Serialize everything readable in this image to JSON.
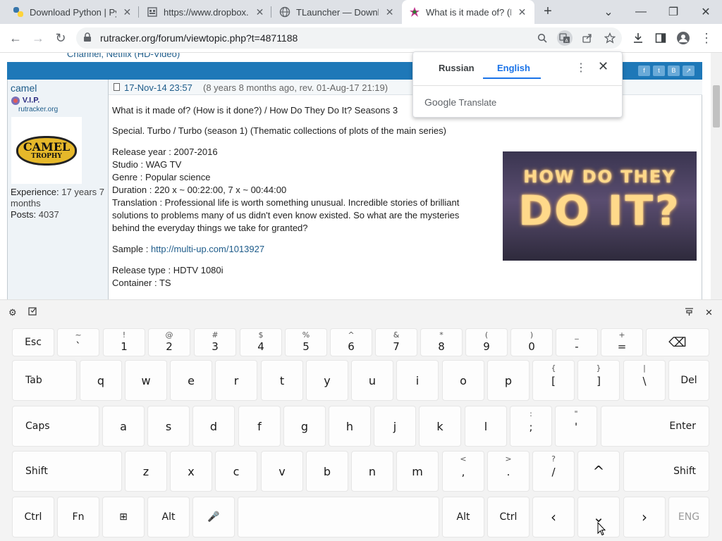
{
  "tabs": [
    {
      "title": "Download Python | Pyt",
      "icon": "python-icon"
    },
    {
      "title": "https://www.dropbox.c",
      "icon": "page-icon"
    },
    {
      "title": "TLauncher — Downloa",
      "icon": "globe-icon"
    },
    {
      "title": "What is it made of? (H",
      "icon": "rutracker-icon",
      "active": true
    }
  ],
  "address": {
    "url": "rutracker.org/forum/viewtopic.php?t=4871188"
  },
  "translate_popup": {
    "source_lang": "Russian",
    "target_lang": "English",
    "brand": "Google",
    "brand_suffix": "Translate"
  },
  "page": {
    "top_link": "Channel, Netflix (HD-Video)",
    "user": {
      "name": "camel",
      "rank": "V.I.P.",
      "site": "rutracker.org",
      "avatar_line1": "CAMEL",
      "avatar_line2": "TROPHY",
      "experience_label": "Experience:",
      "experience_value": "17 years 7 months",
      "posts_label": "Posts:",
      "posts_value": "4037"
    },
    "post": {
      "date": "17-Nov-14 23:57",
      "ago": "(8 years 8 months ago, rev. 01-Aug-17 21:19)",
      "title": "What is it made of? (How is it done?) / How Do They Do It? Seasons 3",
      "special": "Special. Turbo / Turbo (season 1) (Thematic collections of plots of the main series)",
      "release_year": "Release year : 2007-2016",
      "studio": "Studio : WAG TV",
      "genre": "Genre : Popular science",
      "duration": "Duration : 220 x ~ 00:22:00, 7 x ~ 00:44:00",
      "translation_l1": "Translation : Professional life is worth something unusual. Incredible stories of brilliant",
      "translation_l2": "solutions to problems many of us didn't even know existed. So what are the mysteries",
      "translation_l3": "behind the everyday things we take for granted?",
      "sample_label": "Sample :",
      "sample_link": "http://multi-up.com/1013927",
      "release_type": "Release type : HDTV 1080i",
      "container": "Container : TS",
      "poster_line1": "HOW DO THEY",
      "poster_line2": "DO IT?"
    }
  },
  "keyboard": {
    "row1": [
      {
        "sub": "",
        "main": "Esc"
      },
      {
        "sub": "~",
        "main": "`"
      },
      {
        "sub": "!",
        "main": "1"
      },
      {
        "sub": "@",
        "main": "2"
      },
      {
        "sub": "#",
        "main": "3"
      },
      {
        "sub": "$",
        "main": "4"
      },
      {
        "sub": "%",
        "main": "5"
      },
      {
        "sub": "^",
        "main": "6"
      },
      {
        "sub": "&",
        "main": "7"
      },
      {
        "sub": "*",
        "main": "8"
      },
      {
        "sub": "(",
        "main": "9"
      },
      {
        "sub": ")",
        "main": "0"
      },
      {
        "sub": "_",
        "main": "-"
      },
      {
        "sub": "+",
        "main": "="
      }
    ],
    "row2": [
      {
        "main": "Tab"
      },
      {
        "main": "q"
      },
      {
        "main": "w"
      },
      {
        "main": "e"
      },
      {
        "main": "r"
      },
      {
        "main": "t"
      },
      {
        "main": "y"
      },
      {
        "main": "u"
      },
      {
        "main": "i"
      },
      {
        "main": "o"
      },
      {
        "main": "p"
      },
      {
        "sub": "{",
        "main": "["
      },
      {
        "sub": "}",
        "main": "]"
      },
      {
        "sub": "|",
        "main": "\\"
      },
      {
        "main": "Del"
      }
    ],
    "row3": [
      {
        "main": "Caps"
      },
      {
        "main": "a"
      },
      {
        "main": "s"
      },
      {
        "main": "d"
      },
      {
        "main": "f"
      },
      {
        "main": "g"
      },
      {
        "main": "h"
      },
      {
        "main": "j"
      },
      {
        "main": "k"
      },
      {
        "main": "l"
      },
      {
        "sub": ":",
        "main": ";"
      },
      {
        "sub": "\"",
        "main": "'"
      },
      {
        "main": "Enter"
      }
    ],
    "row4": [
      {
        "main": "Shift"
      },
      {
        "main": "z"
      },
      {
        "main": "x"
      },
      {
        "main": "c"
      },
      {
        "main": "v"
      },
      {
        "main": "b"
      },
      {
        "main": "n"
      },
      {
        "main": "m"
      },
      {
        "sub": "<",
        "main": ","
      },
      {
        "sub": ">",
        "main": "."
      },
      {
        "sub": "?",
        "main": "/"
      },
      {
        "main": "^"
      },
      {
        "main": "Shift"
      }
    ],
    "row5": [
      {
        "main": "Ctrl"
      },
      {
        "main": "Fn"
      },
      {
        "main": "⊞"
      },
      {
        "main": "Alt"
      },
      {
        "main": "🎤"
      },
      {
        "main": ""
      },
      {
        "main": "Alt"
      },
      {
        "main": "Ctrl"
      },
      {
        "main": "‹"
      },
      {
        "main": "⌄"
      },
      {
        "main": "›"
      },
      {
        "main": "ENG"
      }
    ],
    "backspace": "⌫"
  }
}
